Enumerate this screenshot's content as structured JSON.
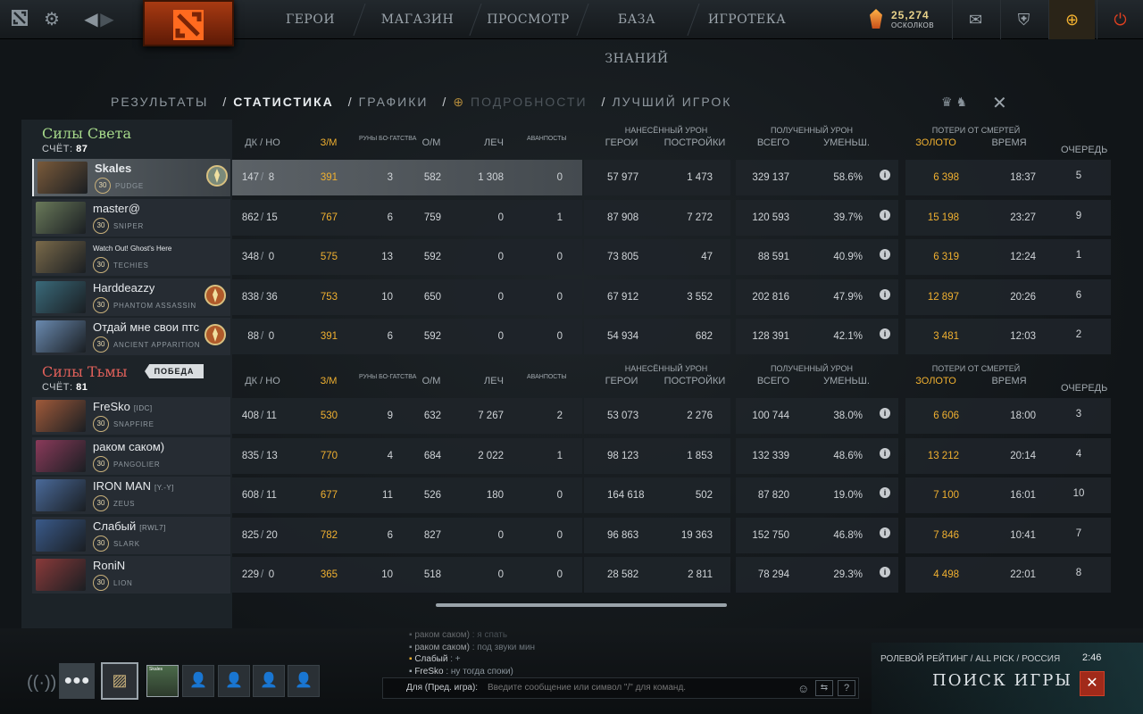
{
  "nav": {
    "items": [
      "ГЕРОИ",
      "МАГАЗИН",
      "ПРОСМОТР",
      "БАЗА ЗНАНИЙ",
      "ИГРОТЕКА"
    ],
    "shards_value": "25,274",
    "shards_label": "ОСКОЛКОВ",
    "icons": [
      "dota-logo-icon",
      "settings-gear-icon",
      "back-arrow-icon",
      "forward-arrow-icon",
      "mail-icon",
      "armory-icon",
      "plus-subscription-icon",
      "power-icon"
    ]
  },
  "tabs": {
    "results": "РЕЗУЛЬТАТЫ",
    "stats": "СТАТИСТИКА",
    "graphs": "ГРАФИКИ",
    "details": "ПОДРОБНОСТИ",
    "best": "ЛУЧШИЙ ИГРОК",
    "sep": "/"
  },
  "columns": {
    "kd": "ДК / НО",
    "xpm": "З/М",
    "runes": "РУНЫ БО-ГАТСТВА",
    "gpm": "О/М",
    "heal": "ЛЕЧ",
    "avanposts": "АВАНПОСТЫ",
    "dmg_dealt": "НАНЕСЁННЫЙ УРОН",
    "heroes": "ГЕРОИ",
    "buildings": "ПОСТРОЙКИ",
    "dmg_taken": "ПОЛУЧЕННЫЙ УРОН",
    "total": "ВСЕГО",
    "reduced": "УМЕНЬШ.",
    "death_losses": "ПОТЕРИ ОТ СМЕРТЕЙ",
    "gold": "ЗОЛОТО",
    "time": "ВРЕМЯ",
    "queue": "ОЧЕРЕДЬ"
  },
  "radiant": {
    "title": "Силы Света",
    "score_label": "СЧЁТ:",
    "score": "87",
    "players": [
      {
        "name": "Skales",
        "tag": "",
        "level": "30",
        "hero": "PUDGE",
        "kd": "147",
        "no": "8",
        "xpm": "391",
        "runes": "3",
        "gpm": "582",
        "heal": "1 308",
        "av": "0",
        "dmg_h": "57 977",
        "dmg_b": "1 473",
        "taken": "329 137",
        "red": "58.6%",
        "gold": "6 398",
        "time": "18:37",
        "queue": "5"
      },
      {
        "name": "master@",
        "tag": "",
        "level": "30",
        "hero": "SNIPER",
        "kd": "862",
        "no": "15",
        "xpm": "767",
        "runes": "6",
        "gpm": "759",
        "heal": "0",
        "av": "1",
        "dmg_h": "87 908",
        "dmg_b": "7 272",
        "taken": "120 593",
        "red": "39.7%",
        "gold": "15 198",
        "time": "23:27",
        "queue": "9"
      },
      {
        "name": "Watch Out! Ghost's Here",
        "tag": "",
        "level": "30",
        "hero": "TECHIES",
        "kd": "348",
        "no": "0",
        "xpm": "575",
        "runes": "13",
        "gpm": "592",
        "heal": "0",
        "av": "0",
        "dmg_h": "73 805",
        "dmg_b": "47",
        "taken": "88 591",
        "red": "40.9%",
        "gold": "6 319",
        "time": "12:24",
        "queue": "1"
      },
      {
        "name": "Harddeazzy",
        "tag": "",
        "level": "30",
        "hero": "PHANTOM ASSASSIN",
        "kd": "838",
        "no": "36",
        "xpm": "753",
        "runes": "10",
        "gpm": "650",
        "heal": "0",
        "av": "0",
        "dmg_h": "67 912",
        "dmg_b": "3 552",
        "taken": "202 816",
        "red": "47.9%",
        "gold": "12 897",
        "time": "20:26",
        "queue": "6"
      },
      {
        "name": "Отдай мне свои птс",
        "tag": "",
        "level": "30",
        "hero": "ANCIENT APPARITION",
        "kd": "88",
        "no": "0",
        "xpm": "391",
        "runes": "6",
        "gpm": "592",
        "heal": "0",
        "av": "0",
        "dmg_h": "54 934",
        "dmg_b": "682",
        "taken": "128 391",
        "red": "42.1%",
        "gold": "3 481",
        "time": "12:03",
        "queue": "2"
      }
    ]
  },
  "dire": {
    "title": "Силы Тьмы",
    "score_label": "СЧЁТ:",
    "score": "81",
    "victory": "ПОБЕДА",
    "players": [
      {
        "name": "FreSko",
        "tag": "[IDC]",
        "level": "30",
        "hero": "SNAPFIRE",
        "kd": "408",
        "no": "11",
        "xpm": "530",
        "runes": "9",
        "gpm": "632",
        "heal": "7 267",
        "av": "2",
        "dmg_h": "53 073",
        "dmg_b": "2 276",
        "taken": "100 744",
        "red": "38.0%",
        "gold": "6 606",
        "time": "18:00",
        "queue": "3"
      },
      {
        "name": "раком саком)",
        "tag": "",
        "level": "30",
        "hero": "PANGOLIER",
        "kd": "835",
        "no": "13",
        "xpm": "770",
        "runes": "4",
        "gpm": "684",
        "heal": "2 022",
        "av": "1",
        "dmg_h": "98 123",
        "dmg_b": "1 853",
        "taken": "132 339",
        "red": "48.6%",
        "gold": "13 212",
        "time": "20:14",
        "queue": "4"
      },
      {
        "name": "IRON MAN",
        "tag": "[Y.-Y]",
        "level": "30",
        "hero": "ZEUS",
        "kd": "608",
        "no": "11",
        "xpm": "677",
        "runes": "11",
        "gpm": "526",
        "heal": "180",
        "av": "0",
        "dmg_h": "164 618",
        "dmg_b": "502",
        "taken": "87 820",
        "red": "19.0%",
        "gold": "7 100",
        "time": "16:01",
        "queue": "10"
      },
      {
        "name": "Слабый",
        "tag": "[RWL7]",
        "level": "30",
        "hero": "SLARK",
        "kd": "825",
        "no": "20",
        "xpm": "782",
        "runes": "6",
        "gpm": "827",
        "heal": "0",
        "av": "0",
        "dmg_h": "96 863",
        "dmg_b": "19 363",
        "taken": "152 750",
        "red": "46.8%",
        "gold": "7 846",
        "time": "10:41",
        "queue": "7"
      },
      {
        "name": "RoniN",
        "tag": "",
        "level": "30",
        "hero": "LION",
        "kd": "229",
        "no": "0",
        "xpm": "365",
        "runes": "10",
        "gpm": "518",
        "heal": "0",
        "av": "0",
        "dmg_h": "28 582",
        "dmg_b": "2 811",
        "taken": "78 294",
        "red": "29.3%",
        "gold": "4 498",
        "time": "22:01",
        "queue": "8"
      }
    ]
  },
  "chat": {
    "lines": [
      {
        "name": "раком саком)",
        "msg": " : я спать"
      },
      {
        "name": "раком саком)",
        "msg": " : под звуки мин"
      },
      {
        "name": "Слабый",
        "msg": " : +"
      },
      {
        "name": "FreSko",
        "msg": " : ну тогда споки)"
      }
    ],
    "channel": "Для (Пред. игра):",
    "placeholder": "Введите сообщение или символ \"/\" для команд.",
    "help": "?"
  },
  "matchmaking": {
    "mode": "РОЛЕВОЙ РЕЙТИНГ / ALL PICK / РОССИЯ",
    "timer": "2:46",
    "find": "ПОИСК ИГРЫ",
    "cancel": "✕"
  },
  "party": {
    "avatar_label": "Skales"
  },
  "colors": {
    "radiant": "#a6d98a",
    "dire": "#e0605a",
    "gold": "#f0b030"
  }
}
